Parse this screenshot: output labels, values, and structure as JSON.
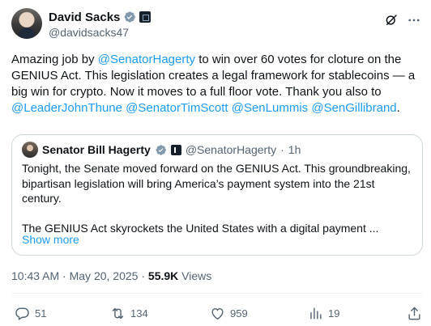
{
  "author": {
    "name": "David Sacks",
    "handle": "@davidsacks47"
  },
  "tweet": {
    "text_parts": [
      {
        "text": "Amazing job by ",
        "mention": false
      },
      {
        "text": "@SenatorHagerty",
        "mention": true
      },
      {
        "text": " to win over 60 votes for cloture on the GENIUS Act. This legislation creates a legal framework for stablecoins — a big win for crypto. Now it moves to a full floor vote. Thank you also to ",
        "mention": false
      },
      {
        "text": "@LeaderJohnThune",
        "mention": true
      },
      {
        "text": " ",
        "mention": false
      },
      {
        "text": "@SenatorTimScott",
        "mention": true
      },
      {
        "text": " ",
        "mention": false
      },
      {
        "text": "@SenLummis",
        "mention": true
      },
      {
        "text": " ",
        "mention": false
      },
      {
        "text": "@SenGillibrand",
        "mention": true
      },
      {
        "text": ".",
        "mention": false
      }
    ]
  },
  "quote": {
    "name": "Senator Bill Hagerty",
    "handle": "@SenatorHagerty",
    "separator": "·",
    "time": "1h",
    "paragraph1": "Tonight, the Senate moved forward on the GENIUS Act. This groundbreaking, bipartisan legislation will bring America’s payment system into the 21st century.",
    "paragraph2": "The GENIUS Act skyrockets the United States with a digital payment ...",
    "show_more": "Show more"
  },
  "meta": {
    "time": "10:43 AM",
    "separator": "·",
    "date": "May 20, 2025",
    "separator2": "·",
    "views_count": "55.9K",
    "views_label": "Views"
  },
  "actions": {
    "replies": "51",
    "reposts": "134",
    "likes": "959",
    "bookmarks": "19"
  },
  "colors": {
    "accent": "#1d9bf0",
    "text": "#0f1419",
    "muted": "#536471",
    "border": "#cfd9de"
  },
  "icons": [
    "verified-badge-icon",
    "affiliate-badge-icon",
    "grok-icon",
    "more-options-icon",
    "reply-icon",
    "repost-icon",
    "like-icon",
    "views-chart-icon",
    "share-icon"
  ]
}
